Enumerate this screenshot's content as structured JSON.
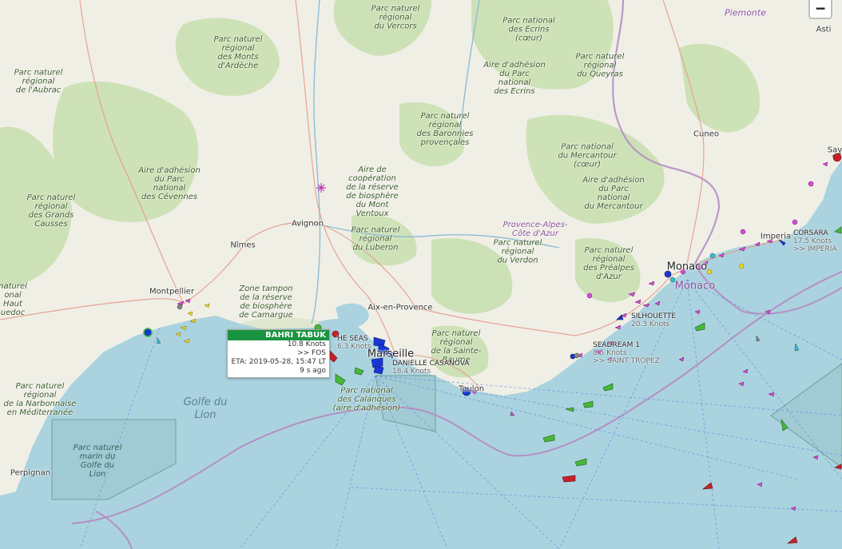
{
  "controls": {
    "zoom_out_label": "−"
  },
  "colors": {
    "sea": "#aad3df",
    "land": "#f0efe6",
    "forest": "#c8dfae",
    "park_outline": "#7ea65e",
    "border": "#b48fc4",
    "ship_cargo": "#47b73a",
    "ship_passenger": "#1a35d6",
    "ship_pleasure": "#d64ad6",
    "ship_tanker": "#c8202a",
    "ship_fishing": "#e6d82a"
  },
  "map": {
    "parks": [
      "Parc naturel\nrégional\ndu Vercors",
      "Parc national\ndes Ecrins\n(cœur)",
      "Aire d'adhésion\ndu Parc\nnational\ndes Ecrins",
      "Parc naturel\nrégional\ndu Queyras",
      "Parc naturel\nrégional\ndes Monts\nd'Ardèche",
      "Parc naturel\nrégional\nde l'Aubrac",
      "Parc naturel\nrégional\ndes Baronnies\nprovençales",
      "Parc national\ndu Mercantour\n(cœur)",
      "Aire d'adhésion\ndu Parc\nnational\ndu Mercantour",
      "Aire d'adhésion\ndu Parc\nnational\ndes Cévennes",
      "Aire de\ncoopération\nde la réserve\nde biosphère\ndu Mont\nVentoux",
      "Parc naturel\nrégional\ndes Grands\nCausses",
      "Parc naturel\nrégional\ndu Luberon",
      "Parc naturel\nrégional\ndu Verdon",
      "Parc naturel\nrégional\ndes Préalpes\nd'Azur",
      "Zone tampon\nde la réserve\nde biosphère\nde Camargue",
      "Parc naturel\nrégional\nde la Sainte-\nBaume",
      "Parc national\ndes Calanques\n(aire d'adhésion)",
      "Parc naturel\nrégional\nde la Narbonnaise\nen Méditerranée",
      "naturel\nonal\nHaut\nuedoc"
    ],
    "sea_parks": [
      "Parc naturel\nmarin du\nGolfe du\nLion"
    ],
    "cities": [
      "Asti",
      "Cuneo",
      "Avignon",
      "Nîmes",
      "Montpellier",
      "Aix-en-Provence",
      "Marseille",
      "Toulon",
      "Monaco",
      "Imperia",
      "Perpignan",
      "Sav"
    ],
    "regions": [
      "Piemonte",
      "Provence-Alpes-\nCôte d'Azur"
    ],
    "monaco_label": "Monaco",
    "sea_labels": [
      "Golfe du\nLion"
    ]
  },
  "ships": [
    {
      "name": "CORSARA",
      "speed": "17.5 Knots",
      "dest": ">> IMPERIA"
    },
    {
      "name": "SILHOUETTE",
      "speed": "20.3 Knots"
    },
    {
      "name": "SEADREAM 1",
      "speed": "8.5 Knots",
      "dest": ">> SAINT TROPEZ"
    },
    {
      "name": "DANIELLE CASANOVA",
      "speed": "18.4 Knots"
    },
    {
      "name": "HE SEAS",
      "speed": "6.3 Knots"
    }
  ],
  "popup": {
    "name": "BAHRI TABUK",
    "speed": "10.8 Knots",
    "dest": ">> FOS",
    "eta": "ETA: 2019-05-28, 15:47 LT",
    "age": "9 s ago"
  }
}
